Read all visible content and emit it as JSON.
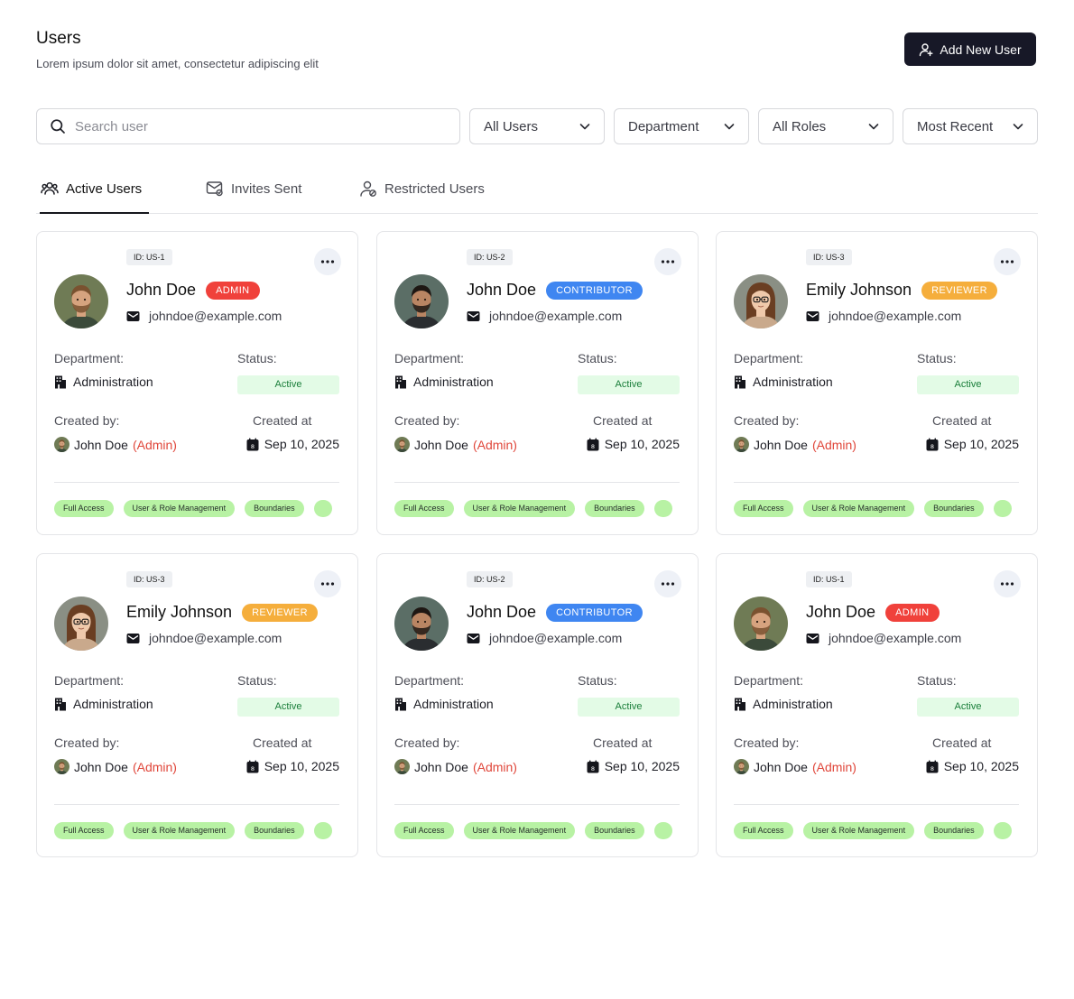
{
  "header": {
    "title": "Users",
    "subtitle": "Lorem ipsum dolor sit amet, consectetur adipiscing elit",
    "add_button": "Add New User"
  },
  "filters": {
    "search_placeholder": "Search user",
    "users": "All Users",
    "department": "Department",
    "roles": "All Roles",
    "sort": "Most Recent"
  },
  "tabs": [
    {
      "label": "Active Users",
      "icon": "users-icon",
      "active": true
    },
    {
      "label": "Invites Sent",
      "icon": "mail-invite-icon",
      "active": false
    },
    {
      "label": "Restricted Users",
      "icon": "user-restricted-icon",
      "active": false
    }
  ],
  "labels": {
    "department": "Department:",
    "status": "Status:",
    "created_by": "Created by:",
    "created_at": "Created at"
  },
  "colors": {
    "admin": "#f0413b",
    "contributor": "#3f86f1",
    "reviewer": "#f5ae3c",
    "primary": "#171827",
    "status_bg": "#e3fbe6",
    "permission_bg": "#b8f2a4"
  },
  "cards": [
    {
      "id": "ID: US-1",
      "name": "John Doe",
      "role": "ADMIN",
      "role_color": "#f0413b",
      "avatar": "man-beard-avatar",
      "email": "johndoe@example.com",
      "department": "Administration",
      "status": "Active",
      "creator": "John Doe",
      "creator_role": "(Admin)",
      "created_at": "Sep 10, 2025",
      "permissions": [
        "Full Access",
        "User & Role Management",
        "Boundaries",
        ""
      ]
    },
    {
      "id": "ID: US-2",
      "name": "John Doe",
      "role": "CONTRIBUTOR",
      "role_color": "#3f86f1",
      "avatar": "man-dark-hair-avatar",
      "email": "johndoe@example.com",
      "department": "Administration",
      "status": "Active",
      "creator": "John Doe",
      "creator_role": "(Admin)",
      "created_at": "Sep 10, 2025",
      "permissions": [
        "Full Access",
        "User & Role Management",
        "Boundaries",
        ""
      ]
    },
    {
      "id": "ID: US-3",
      "name": "Emily Johnson",
      "role": "REVIEWER",
      "role_color": "#f5ae3c",
      "avatar": "woman-glasses-avatar",
      "email": "johndoe@example.com",
      "department": "Administration",
      "status": "Active",
      "creator": "John Doe",
      "creator_role": "(Admin)",
      "created_at": "Sep 10, 2025",
      "permissions": [
        "Full Access",
        "User & Role Management",
        "Boundaries",
        ""
      ]
    },
    {
      "id": "ID: US-3",
      "name": "Emily Johnson",
      "role": "REVIEWER",
      "role_color": "#f5ae3c",
      "avatar": "woman-glasses-avatar",
      "email": "johndoe@example.com",
      "department": "Administration",
      "status": "Active",
      "creator": "John Doe",
      "creator_role": "(Admin)",
      "created_at": "Sep 10, 2025",
      "permissions": [
        "Full Access",
        "User & Role Management",
        "Boundaries",
        ""
      ]
    },
    {
      "id": "ID: US-2",
      "name": "John Doe",
      "role": "CONTRIBUTOR",
      "role_color": "#3f86f1",
      "avatar": "man-dark-hair-avatar",
      "email": "johndoe@example.com",
      "department": "Administration",
      "status": "Active",
      "creator": "John Doe",
      "creator_role": "(Admin)",
      "created_at": "Sep 10, 2025",
      "permissions": [
        "Full Access",
        "User & Role Management",
        "Boundaries",
        ""
      ]
    },
    {
      "id": "ID: US-1",
      "name": "John Doe",
      "role": "ADMIN",
      "role_color": "#f0413b",
      "avatar": "man-beard-avatar",
      "email": "johndoe@example.com",
      "department": "Administration",
      "status": "Active",
      "creator": "John Doe",
      "creator_role": "(Admin)",
      "created_at": "Sep 10, 2025",
      "permissions": [
        "Full Access",
        "User & Role Management",
        "Boundaries",
        ""
      ]
    }
  ]
}
